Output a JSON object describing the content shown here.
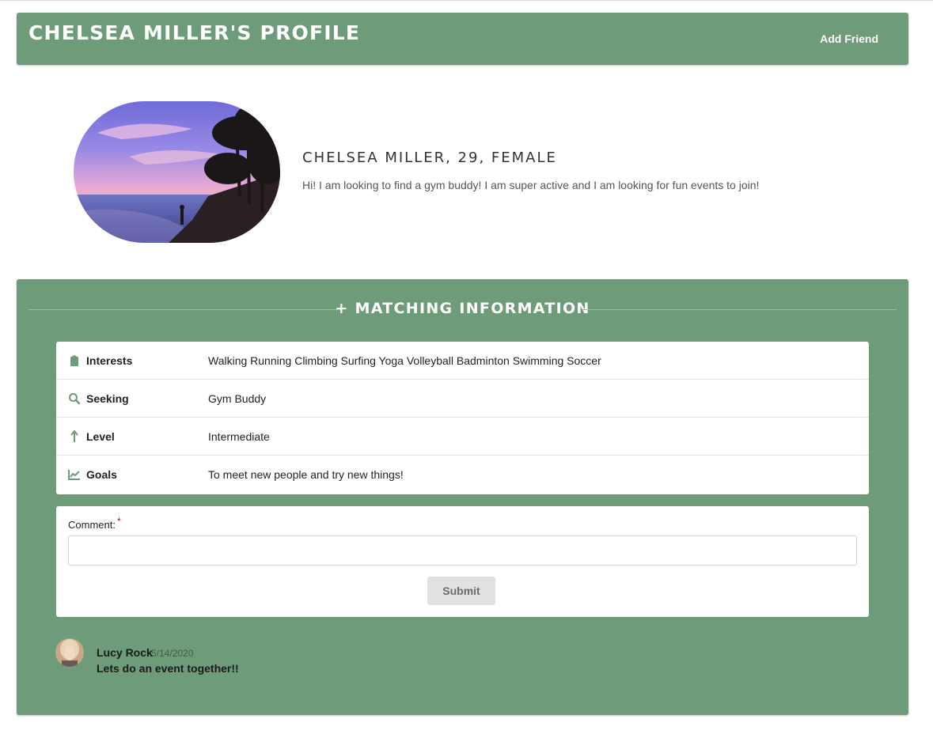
{
  "header": {
    "title": "Chelsea Miller's Profile",
    "add_friend_label": "Add Friend"
  },
  "profile": {
    "headline": "CHELSEA MILLER, 29, FEMALE",
    "bio": "Hi! I am looking to find a gym buddy! I am super active and I am looking for fun events to join!",
    "photo_icon": "sunset-beach-photo"
  },
  "matching": {
    "title": "+ Matching Information",
    "rows": [
      {
        "icon": "clipboard-icon",
        "label": "Interests",
        "value": "Walking Running Climbing Surfing Yoga Volleyball Badminton Swimming Soccer"
      },
      {
        "icon": "search-icon",
        "label": "Seeking",
        "value": "Gym Buddy"
      },
      {
        "icon": "arrow-up-icon",
        "label": "Level",
        "value": "Intermediate"
      },
      {
        "icon": "line-chart-icon",
        "label": "Goals",
        "value": "To meet new people and try new things!"
      }
    ]
  },
  "comment_form": {
    "label": "Comment:",
    "required_mark": "*",
    "input_value": "",
    "submit_label": "Submit"
  },
  "comments": [
    {
      "author": "Lucy Rock",
      "date": "5/14/2020",
      "text": "Lets do an event together!!"
    }
  ],
  "colors": {
    "panel_green": "#6e9b7a",
    "white": "#ffffff",
    "button_gray": "#e0e1e2"
  }
}
